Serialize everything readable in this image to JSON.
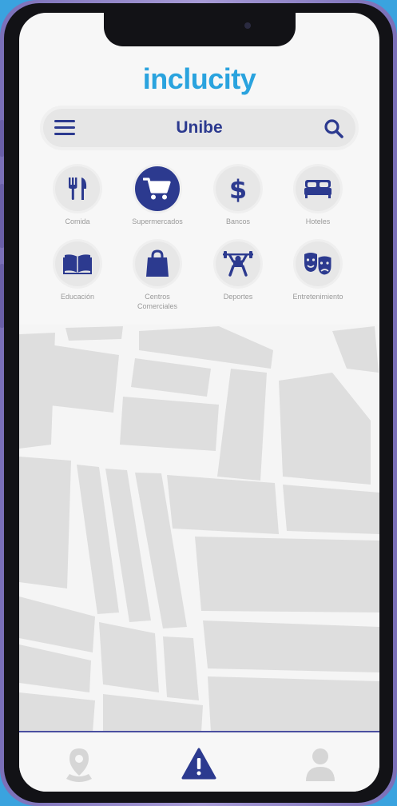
{
  "app": {
    "logo": "inclucity"
  },
  "search": {
    "title": "Unibe"
  },
  "categories": [
    {
      "label": "Comida",
      "icon": "utensils-icon",
      "active": false
    },
    {
      "label": "Supermercados",
      "icon": "shopping-cart-icon",
      "active": true
    },
    {
      "label": "Bancos",
      "icon": "dollar-icon",
      "active": false
    },
    {
      "label": "Hoteles",
      "icon": "bed-icon",
      "active": false
    },
    {
      "label": "Educación",
      "icon": "book-icon",
      "active": false
    },
    {
      "label": "Centros\nComerciales",
      "icon": "shopping-bag-icon",
      "active": false
    },
    {
      "label": "Deportes",
      "icon": "weightlifter-icon",
      "active": false
    },
    {
      "label": "Entretenimiento",
      "icon": "theater-masks-icon",
      "active": false
    }
  ],
  "bottom_nav": [
    {
      "icon": "location-pin-icon",
      "active": false
    },
    {
      "icon": "warning-icon",
      "active": true
    },
    {
      "icon": "user-icon",
      "active": false
    }
  ],
  "colors": {
    "primary": "#2c3a8f",
    "brand": "#2aa3de",
    "inactive": "#d6d6d6"
  }
}
